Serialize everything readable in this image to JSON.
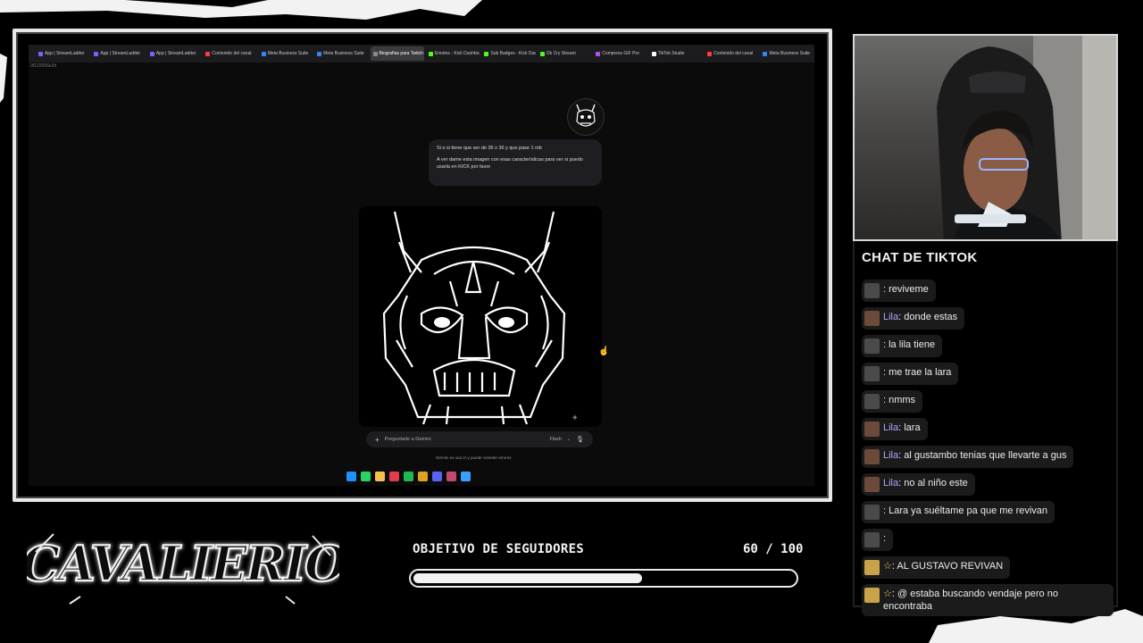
{
  "browser": {
    "tabs": [
      {
        "label": "App | StreamLadder",
        "color": "#7b61ff"
      },
      {
        "label": "App | StreamLadder",
        "color": "#7b61ff"
      },
      {
        "label": "App | StreamLadder",
        "color": "#7b61ff"
      },
      {
        "label": "Contenido del canal",
        "color": "#ff3b3b"
      },
      {
        "label": "Meta Business Suite",
        "color": "#3b82f6"
      },
      {
        "label": "Meta Business Suite",
        "color": "#3b82f6"
      },
      {
        "label": "Biografías para Twitch y Kick",
        "color": "#8a8a8a",
        "active": true
      },
      {
        "label": "Emotes - Kick Dashboard",
        "color": "#53fc18"
      },
      {
        "label": "Sub Badges - Kick Dashboard",
        "color": "#53fc18"
      },
      {
        "label": "Ok Cry Stream",
        "color": "#53fc18"
      },
      {
        "label": "Compress GIF Pro",
        "color": "#a855f7"
      },
      {
        "label": "TikTok Studio",
        "color": "#ffffff"
      },
      {
        "label": "Contenido del canal",
        "color": "#ff3b3b"
      },
      {
        "label": "Meta Business Suite",
        "color": "#3b82f6"
      }
    ],
    "url_hint": "0f122696e2d"
  },
  "gemini": {
    "user_message_1": "Si o si tiene que ser de 36 x 36 y que pase 1 mb",
    "user_message_2": "A ver dame esta imagen con esas características para ver si puedo usarla en KICK por favor",
    "prompt_placeholder": "Preguntarle a Gemini",
    "model": "Flash",
    "disclaimer": "Gemini es una IA y puede cometer errores."
  },
  "taskbar_icons": [
    {
      "name": "windows-icon",
      "color": "#1e90ff"
    },
    {
      "name": "whatsapp-icon",
      "color": "#25d366"
    },
    {
      "name": "folder-icon",
      "color": "#f2c14e"
    },
    {
      "name": "app-red-icon",
      "color": "#e23b4a"
    },
    {
      "name": "spotify-icon",
      "color": "#1db954"
    },
    {
      "name": "chrome-icon",
      "color": "#e0a020"
    },
    {
      "name": "discord-icon",
      "color": "#5865f2"
    },
    {
      "name": "obs-icon",
      "color": "#c04a70"
    },
    {
      "name": "browser-icon",
      "color": "#3aa0ff"
    }
  ],
  "chat": {
    "title": "CHAT DE TIKTOK",
    "messages": [
      {
        "name": "",
        "text": ": reviveme",
        "avatar": "#4a4a4a"
      },
      {
        "name": "Lila",
        "text": ": donde estas",
        "avatar": "#6b4a3a"
      },
      {
        "name": "",
        "text": ": la lila tiene",
        "avatar": "#4a4a4a"
      },
      {
        "name": "",
        "text": ": me trae la lara",
        "avatar": "#4a4a4a"
      },
      {
        "name": "",
        "text": ": nmms",
        "avatar": "#4a4a4a"
      },
      {
        "name": "Lila",
        "text": ": lara",
        "avatar": "#6b4a3a"
      },
      {
        "name": "Lila",
        "text": ": al gustambo tenias que llevarte a gus",
        "avatar": "#6b4a3a"
      },
      {
        "name": "Lila",
        "text": ": no al niño este",
        "avatar": "#6b4a3a"
      },
      {
        "name": "",
        "text": ": Lara ya suéltame pa que me revivan",
        "avatar": "#4a4a4a"
      },
      {
        "name": "",
        "text": ":",
        "avatar": "#4a4a4a"
      },
      {
        "name": "☆",
        "text": ": AL GUSTAVO REVIVAN",
        "avatar": "#c9a24a"
      },
      {
        "name": "☆",
        "text": ": @ estaba buscando vendaje pero no encontraba",
        "avatar": "#c9a24a"
      }
    ]
  },
  "logo": {
    "text": "CAVALIERIO"
  },
  "goal": {
    "label": "OBJETIVO DE SEGUIDORES",
    "count_text": "60 / 100",
    "current": 60,
    "target": 100
  }
}
